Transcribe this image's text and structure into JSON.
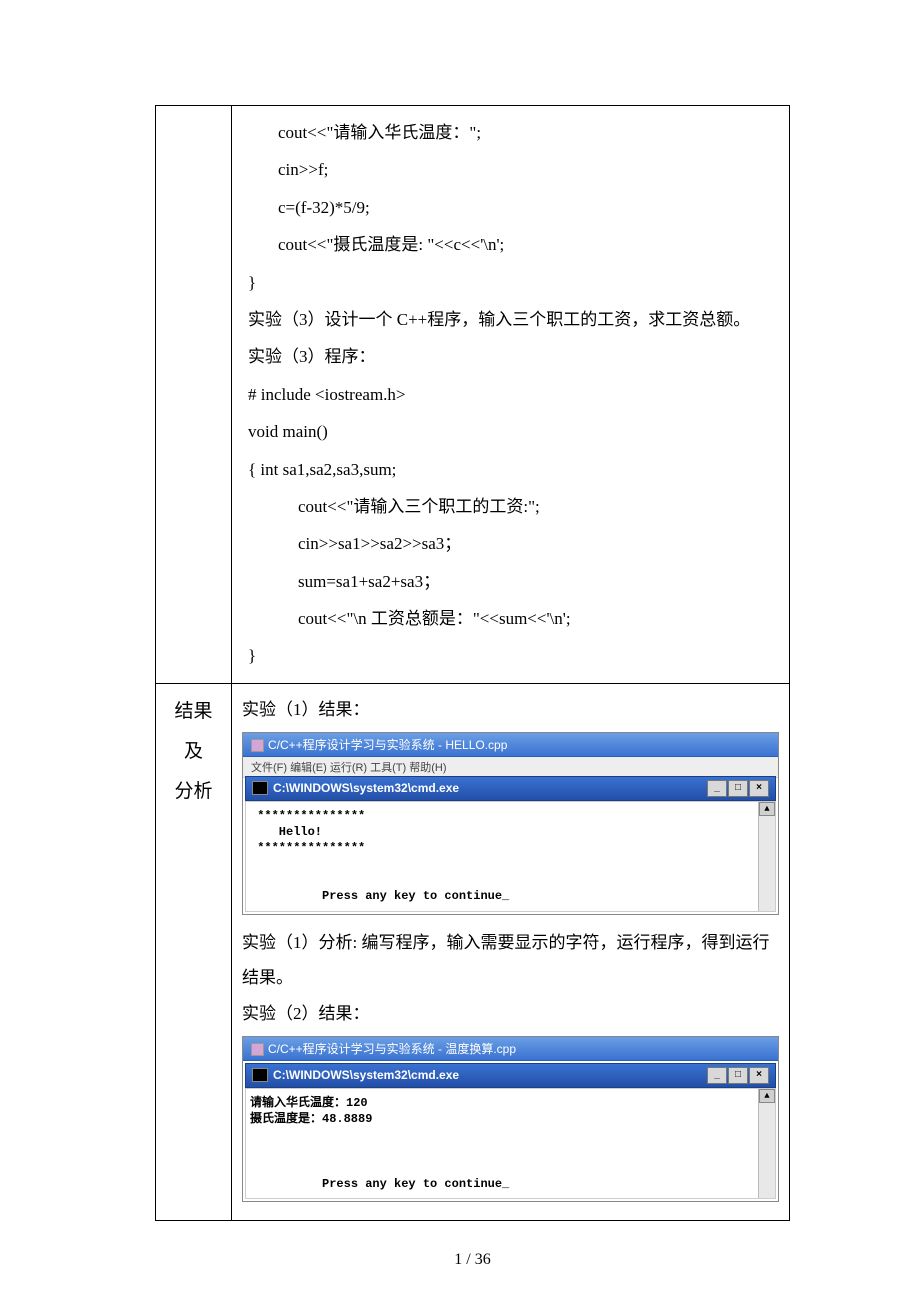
{
  "row1": {
    "l1": "cout<<\"请输入华氏温度：\";",
    "l2": "cin>>f;",
    "l3": "c=(f-32)*5/9;",
    "l4": "cout<<\"摄氏温度是: \"<<c<<'\\n';",
    "l5": "}",
    "l6": "实验（3）设计一个 C++程序，输入三个职工的工资，求工资总额。",
    "l7": "实验（3）程序：",
    "l8": "# include <iostream.h>",
    "l9": "void main()",
    "l10": "{    int sa1,sa2,sa3,sum;",
    "l11": "cout<<\"请输入三个职工的工资:\";",
    "l12": "cin>>sa1>>sa2>>sa3；",
    "l13": "sum=sa1+sa2+sa3；",
    "l14": "cout<<\"\\n 工资总额是：\"<<sum<<'\\n';",
    "l15": "}"
  },
  "row2": {
    "side1": "结果",
    "side2": "及",
    "side3": "分析",
    "r1_label": "实验（1）结果：",
    "r1_analysis": "实验（1）分析: 编写程序，输入需要显示的字符，运行程序，得到运行结果。",
    "r2_label": "实验（2）结果："
  },
  "shot1": {
    "title1": "C/C++程序设计学习与实验系统 - HELLO.cpp",
    "menu": "文件(F)  编辑(E)  运行(R)  工具(T)  帮助(H)",
    "title2": "C:\\WINDOWS\\system32\\cmd.exe",
    "out": " ***************\n    Hello!\n ***************\n\n\n          Press any key to continue_"
  },
  "shot2": {
    "title1": "C/C++程序设计学习与实验系统 - 温度换算.cpp",
    "title2": "C:\\WINDOWS\\system32\\cmd.exe",
    "out": "请输入华氏温度：120\n摄氏温度是：48.8889\n\n\n\n          Press any key to continue_"
  },
  "btn": {
    "min": "_",
    "max": "□",
    "close": "×",
    "up": "▲"
  },
  "footer": "1  /  36"
}
